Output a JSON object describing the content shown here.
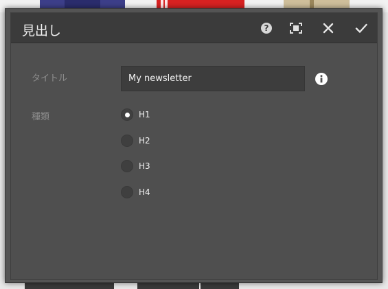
{
  "dialog": {
    "title": "見出し",
    "header_buttons": {
      "help": "help-icon",
      "fullscreen": "fullscreen-icon",
      "close": "close-icon",
      "done": "checkmark-icon"
    }
  },
  "form": {
    "title_label": "タイトル",
    "title_value": "My newsletter",
    "type_label": "種類",
    "heading_options": [
      {
        "label": "H1",
        "selected": true
      },
      {
        "label": "H2",
        "selected": false
      },
      {
        "label": "H3",
        "selected": false
      },
      {
        "label": "H4",
        "selected": false
      }
    ]
  },
  "colors": {
    "dialog_bg": "#4f4f4f",
    "header_bg": "#3b3b3b",
    "input_bg": "#3d3d3d",
    "label_color": "#8e8e8e"
  }
}
